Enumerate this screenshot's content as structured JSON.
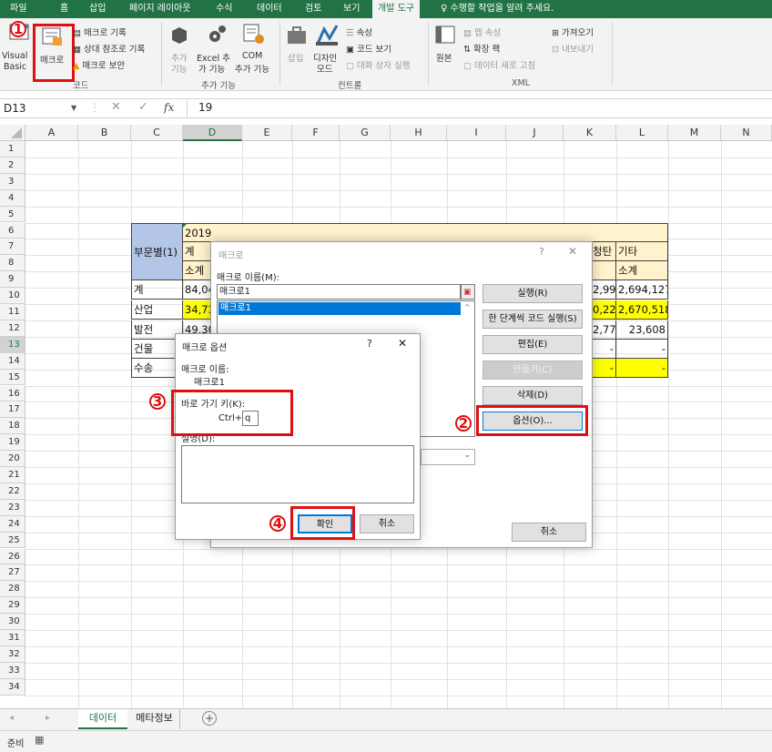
{
  "ribbon_tabs": [
    "파일",
    "홈",
    "삽입",
    "페이지 레이아웃",
    "수식",
    "데이터",
    "검토",
    "보기",
    "개발 도구"
  ],
  "tell_me": "수행할 작업을 알려 주세요.",
  "code_group": {
    "vb_line1": "Visual",
    "vb_line2": "Basic",
    "macro": "매크로",
    "record": "매크로 기록",
    "relative": "상대 참조로 기록",
    "security": "매크로 보안",
    "label": "코드"
  },
  "addin_group": {
    "addin1": "추가",
    "addin2": "기능",
    "excel_addin1": "Excel 추",
    "excel_addin2": "가 기능",
    "com1": "COM",
    "com2": "추가 기능",
    "label": "추가 기능"
  },
  "controls_group": {
    "insert": "삽입",
    "design1": "디자인",
    "design2": "모드",
    "properties": "속성",
    "view_code": "코드 보기",
    "run_dialog": "대화 상자 실행",
    "label": "컨트롤"
  },
  "xml_group": {
    "source": "원본",
    "map_props": "맵 속성",
    "expansion": "확장 팩",
    "refresh": "데이터 새로 고침",
    "import": "가져오기",
    "export": "내보내기",
    "label": "XML"
  },
  "formula_bar": {
    "name_box": "D13",
    "fx": "fx",
    "value": "19"
  },
  "columns": [
    "A",
    "B",
    "C",
    "D",
    "E",
    "F",
    "G",
    "H",
    "I",
    "J",
    "K",
    "L",
    "M",
    "N"
  ],
  "rows": [
    "1",
    "2",
    "3",
    "4",
    "5",
    "6",
    "7",
    "8",
    "9",
    "10",
    "11",
    "12",
    "13",
    "14",
    "15",
    "16",
    "17",
    "18",
    "19",
    "20",
    "21",
    "22",
    "23",
    "24",
    "25",
    "26",
    "27",
    "28",
    "29",
    "30",
    "31",
    "32",
    "33",
    "34"
  ],
  "table": {
    "header_dept": "부문별(1)",
    "year": "2019",
    "total": "계",
    "subtotal": "소계",
    "c_rows": [
      "계",
      "산업",
      "발전",
      "건물",
      "수송"
    ],
    "d_vals": [
      "84,04",
      "34,73",
      "49,30"
    ],
    "col_k_header": "청탄",
    "col_l_header": "기타",
    "col_l_sub": "소계",
    "k_vals": [
      "2,994",
      "0,221",
      "2,773",
      "-",
      "-"
    ],
    "l_vals": [
      "2,694,127",
      "2,670,518",
      "23,608",
      "-",
      "-"
    ]
  },
  "macro_dialog": {
    "title": "매크로",
    "help": "?",
    "close": "✕",
    "name_label": "매크로 이름(M):",
    "name_value": "매크로1",
    "list": [
      "매크로1"
    ],
    "run": "실행(R)",
    "step": "한 단계씩 코드 실행(S)",
    "edit": "편집(E)",
    "create": "만들기(C)",
    "delete": "삭제(D)",
    "options": "옵션(O)...",
    "cancel": "취소"
  },
  "options_dialog": {
    "title": "매크로 옵션",
    "help": "?",
    "close": "✕",
    "name_label": "매크로 이름:",
    "name_value": "매크로1",
    "shortcut_label": "바로 가기 키(K):",
    "ctrl": "Ctrl+",
    "shortcut_value": "q",
    "desc_label": "설명(D):",
    "ok": "확인",
    "cancel": "취소"
  },
  "annotations": [
    "1",
    "2",
    "3",
    "4"
  ],
  "sheet_tabs": [
    "데이터",
    "메타정보"
  ],
  "add_sheet": "+",
  "status": "준비",
  "colors": {
    "excel_green": "#217346",
    "highlight_yellow": "#ffff00",
    "header_blue": "#b4c6e7",
    "year_bg": "#fff2cc",
    "red": "#e01010"
  }
}
